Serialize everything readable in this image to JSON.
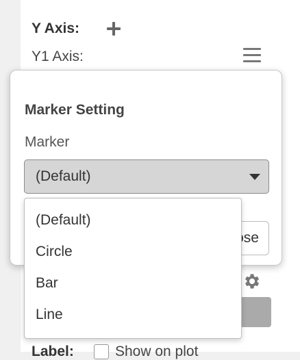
{
  "yaxis": {
    "title": "Y Axis:",
    "add_icon": "plus-icon",
    "y1_label": "Y1 Axis:",
    "menu_icon": "hamburger-icon"
  },
  "background": {
    "gear_icon": "gear-icon",
    "label_text": "Label:",
    "show_on_plot": "Show on plot"
  },
  "popover": {
    "title": "Marker Setting",
    "marker_label": "Marker",
    "selected_value": "(Default)",
    "close_label": "Close"
  },
  "dropdown": {
    "options": [
      "(Default)",
      "Circle",
      "Bar",
      "Line"
    ]
  }
}
